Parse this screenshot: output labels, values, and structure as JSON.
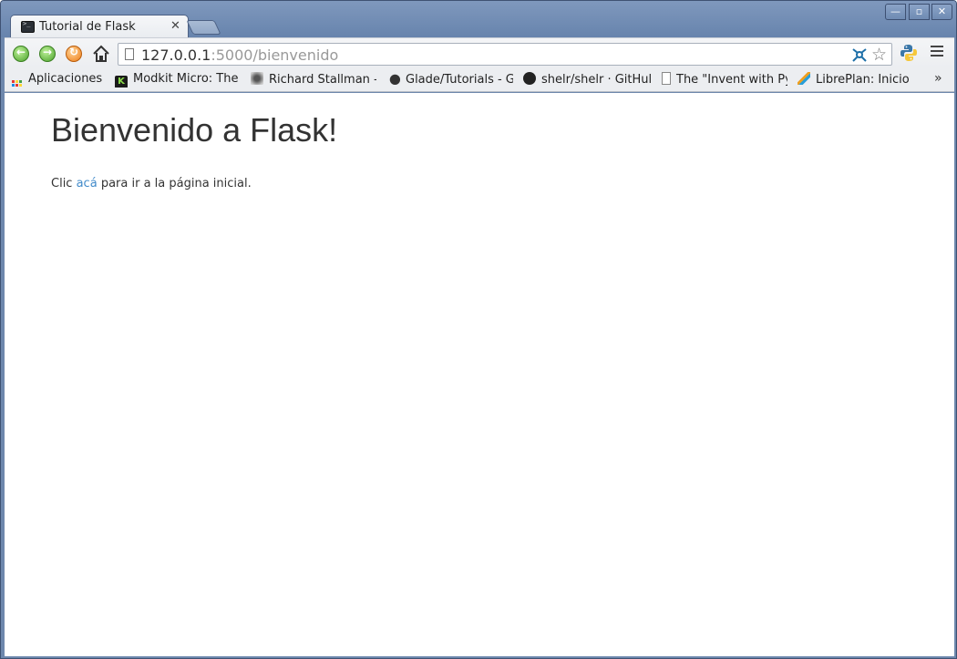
{
  "tab": {
    "title": "Tutorial de Flask",
    "close_glyph": "✕"
  },
  "window_controls": {
    "minimize": "—",
    "maximize": "▫",
    "close": "✕"
  },
  "toolbar": {
    "back_glyph": "←",
    "forward_glyph": "→",
    "reload_glyph": "↻",
    "url_host": "127.0.0.1",
    "url_rest": ":5000/bienvenido",
    "extension_icon": "network-extension-icon",
    "bookmark_glyph": "☆"
  },
  "bookmarks": {
    "items": [
      {
        "label": "Aplicaciones",
        "icon": "apps-grid-icon"
      },
      {
        "label": "Modkit Micro: The I",
        "icon": "modkit-icon"
      },
      {
        "label": "Richard Stallman -",
        "icon": "stallman-icon"
      },
      {
        "label": "Glade/Tutorials - G",
        "icon": "gnome-foot-icon"
      },
      {
        "label": "shelr/shelr · GitHul",
        "icon": "github-icon"
      },
      {
        "label": "The \"Invent with Py",
        "icon": "page-icon"
      },
      {
        "label": "LibrePlan: Inicio",
        "icon": "libreplan-icon"
      }
    ],
    "overflow_glyph": "»"
  },
  "page": {
    "heading": "Bienvenido a Flask!",
    "para_before": "Clic ",
    "link_text": "acá",
    "para_after": " para ir a la página inicial."
  },
  "colors": {
    "frame": "#6e88ad",
    "link": "#428bca",
    "text": "#333333"
  }
}
